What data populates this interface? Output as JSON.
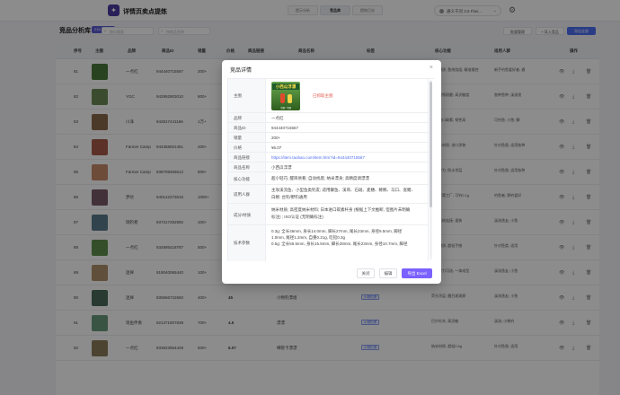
{
  "app": {
    "title": "详情页卖点提炼",
    "logo_glyph": "✦"
  },
  "tabs": [
    {
      "label": "提示分析",
      "active": false
    },
    {
      "label": "竞品库",
      "active": true
    },
    {
      "label": "提炼日志",
      "active": false
    }
  ],
  "model": {
    "label": "通义千问 3.5 Flas...",
    "caret": "⌄"
  },
  "gear_glyph": "⚙",
  "page": {
    "title": "竞品分析库",
    "count_badge": "215 条记录",
    "search_placeholder": "按ID搜索",
    "search2_placeholder": "按商品名称",
    "btn_batch": "批量管理",
    "btn_import": "+ 导入竞品",
    "btn_export": "导出全部"
  },
  "table": {
    "headers": [
      "序号",
      "主图",
      "品牌",
      "商品ID",
      "销量",
      "价格",
      "商品链接",
      "商品名称",
      "标签",
      "核心功能",
      "适用人群",
      "操作"
    ],
    "op_icons": [
      "👁",
      "⤓",
      "🗑"
    ],
    "rows": [
      {
        "idx": "81",
        "brand": "一点红",
        "id": "944440715567",
        "sales": "200+",
        "price": "",
        "name": "",
        "tag": "",
        "func": "纳米材质; 鱼线绕组; 精准操控",
        "people": "新手钓鱼爱好者; 通"
      },
      {
        "idx": "82",
        "brand": "YGC",
        "id": "942992903010",
        "sales": "800+",
        "price": "",
        "name": "",
        "tag": "",
        "func": "鱼线强韧耐磨; 高灵敏度",
        "people": "各种鱼种; 溪流渔"
      },
      {
        "idx": "83",
        "brand": "川泽",
        "id": "942817441166",
        "sales": "1万+",
        "price": "",
        "name": "",
        "tag": "",
        "func": "原装进口碳素; 韧性高",
        "people": "可钓鱼; 小鱼; 鲫"
      },
      {
        "idx": "84",
        "brand": "Farmer Camp",
        "id": "944358001451",
        "sales": "200+",
        "price": "",
        "name": "",
        "tag": "",
        "func": "手工木材质; 进口涂装",
        "people": "针对鱼类; 适用各种"
      },
      {
        "idx": "85",
        "brand": "Farmer Camp",
        "id": "938709465612",
        "sales": "500+",
        "price": "",
        "name": "",
        "tag": "",
        "func": "外包浮力; 防水涂层",
        "people": "针对鱼类; 适用各种"
      },
      {
        "idx": "86",
        "brand": "梦达",
        "id": "940142273615",
        "sales": "1000+",
        "price": "",
        "name": "",
        "tag": "",
        "func": "钓鱼打窝工厂; 可钓0.1g",
        "people": "钓鱼者; 野钓爱好"
      },
      {
        "idx": "87",
        "brand": "瑞钓者",
        "id": "937317282992",
        "sales": "100+",
        "price": "",
        "name": "",
        "tag": "",
        "func": "鱼线无结连接; 速装",
        "people": "溪流渔友; 小鱼"
      },
      {
        "idx": "88",
        "brand": "一点红",
        "id": "934995418787",
        "sales": "500+",
        "price": "",
        "name": "",
        "tag": "",
        "func": "纳米材质; 超轻手感",
        "people": "针对鱼类; 适用"
      },
      {
        "idx": "89",
        "brand": "迷犀",
        "id": "919040065440",
        "sales": "100+",
        "price": "45",
        "name": "迷犀 水清溪流微物钓组",
        "tag": "小物钓漂",
        "func": "四种浮力可选; 一体成型",
        "people": "溪流渔友; 小鱼"
      },
      {
        "idx": "90",
        "brand": "迷犀",
        "id": "930666722660",
        "sales": "400+",
        "price": "45",
        "name": "小物钓漂组",
        "tag": "小物钓漂",
        "func": "荧光涂层; 醒目易观察",
        "people": "溪流渔友; 小鱼"
      },
      {
        "idx": "91",
        "brand": "现鱼伴奏",
        "id": "921371907839",
        "sales": "700+",
        "price": "4.5",
        "name": "漂漂",
        "tag": "小物钓漂",
        "func": "巴尔杉木; 高灵敏",
        "people": "溪流; 小物钓"
      },
      {
        "idx": "92",
        "brand": "一点红",
        "id": "933923954429",
        "sales": "500+",
        "price": "6.07",
        "name": "细管卡漂漂",
        "tag": "小物钓漂",
        "func": "纳米材质; 超轻0.5g",
        "people": "针对鱼类; 适用"
      }
    ]
  },
  "modal": {
    "title": "竞品详情",
    "close_glyph": "×",
    "image_caption": "小西瓜浮漂",
    "image_note": "主图 / 主图",
    "image_status": "已抓取主图",
    "fields": [
      {
        "key": "主图",
        "value": ""
      },
      {
        "key": "品牌",
        "value": "一点红"
      },
      {
        "key": "商品ID",
        "value": "944440715567"
      },
      {
        "key": "销量",
        "value": "200+"
      },
      {
        "key": "价格",
        "value": "¥6.07"
      },
      {
        "key": "商品链接",
        "value": "https://item.taobao.com/item.htm?id=944440715567"
      },
      {
        "key": "商品名称",
        "value": "小西瓜浮漂"
      },
      {
        "key": "核心功能",
        "value": "超小轻巧; 醒目易看; 自动找底; 纳米漂身; 高精度调漂漂"
      },
      {
        "key": "适用人群",
        "line1": "主攻溪流鱼、小型鱼类钓友; 适用鲫鱼、溪哥、石斑、麦穗、鲦鲦、马口、宽鳍、",
        "line2": "白鲦; 台钓/野钓通用"
      },
      {
        "key": "成分/材质",
        "line1": "纳米材质; 高密度纳米材料; 日本进口碳素杆身 (根据上下文推断, 但图片未明确",
        "line2": "标注) ; ISO认证 (无明确标注)"
      },
      {
        "key": "技术参数",
        "line1": "0.3g: 全长46mm, 身长14.0mm, 脚长27mm, 尾长23mm, 身径9.5mm, 脚径",
        "line2": "1.0mm, 尾径1.2mm, 自重0.21g, 吃铅0.3g",
        "line3": "0.5g: 全长56.5mm, 身长15.5mm, 脚长28mm, 尾长23mm, 身径10.7mm, 脚径"
      }
    ],
    "btn_close": "关闭",
    "btn_edit": "编辑",
    "btn_export": "导出 Excel"
  },
  "colors": {
    "accent": "#7b61ff",
    "link": "#4e6ef2",
    "brand_logo": "#4b3ba3"
  }
}
